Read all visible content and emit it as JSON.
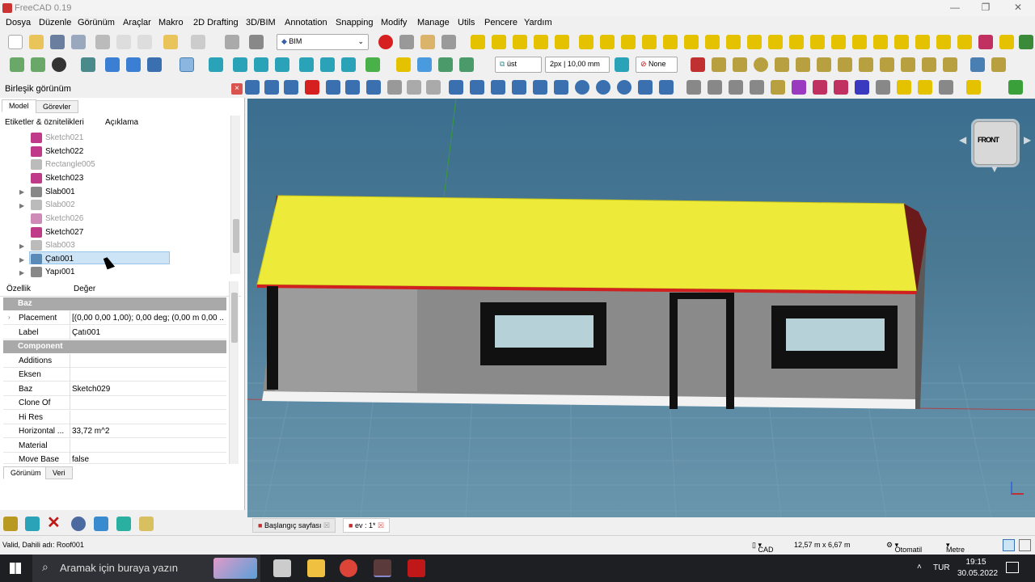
{
  "window": {
    "title": "FreeCAD 0.19"
  },
  "menu": [
    "Dosya",
    "Düzenle",
    "Görünüm",
    "Araçlar",
    "Makro",
    "2D Drafting",
    "3D/BIM",
    "Annotation",
    "Snapping",
    "Modify",
    "Manage",
    "Utils",
    "Pencere",
    "Yardım"
  ],
  "toolbar": {
    "workbench": "BIM",
    "working_plane": "üst",
    "line_style": "2px | 10,00 mm",
    "snap_none": "None"
  },
  "combo_view": {
    "title": "Birleşik görünüm",
    "close": "×",
    "tabs": [
      "Model",
      "Görevler"
    ],
    "tree_headers": [
      "Etiketler & öznitelikleri",
      "Açıklama"
    ],
    "tree_items": [
      {
        "label": "Sketch021",
        "dim": true
      },
      {
        "label": "Sketch022",
        "dim": false
      },
      {
        "label": "Rectangle005",
        "dim": true
      },
      {
        "label": "Sketch023",
        "dim": false
      },
      {
        "label": "Slab001",
        "dim": false
      },
      {
        "label": "Slab002",
        "dim": true
      },
      {
        "label": "Sketch026",
        "dim": true
      },
      {
        "label": "Sketch027",
        "dim": false
      },
      {
        "label": "Slab003",
        "dim": true
      },
      {
        "label": "Çatı001",
        "dim": false,
        "selected": true
      },
      {
        "label": "Yapı001",
        "dim": false
      }
    ],
    "prop_headers": [
      "Özellik",
      "Değer"
    ],
    "groups": {
      "base": "Baz",
      "component": "Component"
    },
    "properties_base": [
      {
        "k": "Placement",
        "v": "[(0,00 0,00 1,00); 0,00 deg; (0,00 m  0,00 ..."
      },
      {
        "k": "Label",
        "v": "Çatı001"
      }
    ],
    "properties_component": [
      {
        "k": "Additions",
        "v": ""
      },
      {
        "k": "Eksen",
        "v": ""
      },
      {
        "k": "Baz",
        "v": "Sketch029"
      },
      {
        "k": "Clone Of",
        "v": ""
      },
      {
        "k": "Hi Res",
        "v": ""
      },
      {
        "k": "Horizontal ...",
        "v": "33,72 m^2"
      },
      {
        "k": "Material",
        "v": ""
      },
      {
        "k": "Move Base",
        "v": "false"
      }
    ],
    "bottom_tabs": [
      "Görünüm",
      "Veri"
    ]
  },
  "viewport": {
    "navcube_face": "FRONT"
  },
  "doc_tabs": [
    "Başlangıç sayfası",
    "ev : 1*"
  ],
  "status": {
    "message": "Valid, Dahili adı: Roof001",
    "nav_style": "CAD",
    "dimensions": "12,57 m x 6,67 m",
    "unit_mode": "Otomatil",
    "unit": "Metre"
  },
  "taskbar": {
    "search": "Aramak için buraya yazın",
    "lang": "TUR",
    "time": "19:15",
    "date": "30.05.2022"
  }
}
